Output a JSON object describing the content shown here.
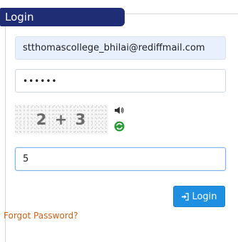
{
  "login": {
    "title": "Login",
    "email_value": "stthomascollege_bhilai@rediffmail.com",
    "password_value": "••••••",
    "captcha_text": "2 + 3",
    "captcha_answer_value": "5",
    "submit_label": "Login",
    "forgot_link": "Forgot Password?"
  },
  "icons": {
    "audio": "speaker-icon",
    "refresh": "refresh-icon",
    "submit": "sign-in-icon"
  },
  "colors": {
    "header": "#1f2d74",
    "button": "#1e8fe1",
    "link": "#c8611a"
  }
}
